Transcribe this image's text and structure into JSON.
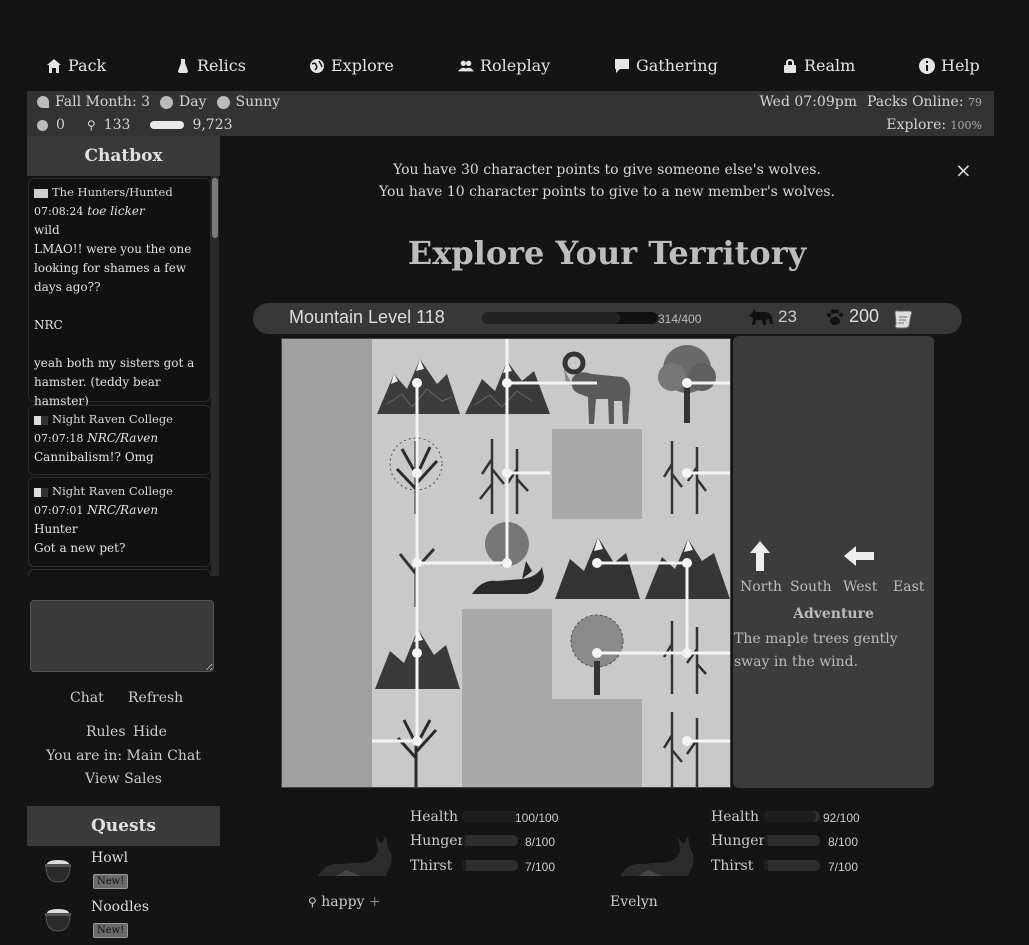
{
  "nav": [
    {
      "label": "Pack",
      "icon": "house-icon"
    },
    {
      "label": "Relics",
      "icon": "flask-icon"
    },
    {
      "label": "Explore",
      "icon": "globe-icon"
    },
    {
      "label": "Roleplay",
      "icon": "users-icon"
    },
    {
      "label": "Gathering",
      "icon": "chat-icon"
    },
    {
      "label": "Realm",
      "icon": "lock-icon"
    },
    {
      "label": "Help",
      "icon": "info-icon"
    }
  ],
  "status": {
    "season": "Fall Month: 3",
    "time_of_day": "Day",
    "weather": "Sunny",
    "datetime": "Wed 07:09pm",
    "packs_online_label": "Packs Online:",
    "packs_online": "79",
    "explore_label": "Explore:",
    "explore_value": "100%",
    "currency_a": "0",
    "currency_b": "133",
    "bones": "9,723"
  },
  "chatbox": {
    "title": "Chatbox",
    "messages": [
      {
        "pack": "The Hunters/Hunted",
        "time": "07:08:24",
        "who": "toe licker",
        "lines": [
          "wild",
          "LMAO!! were you the one looking for shames a few days ago??",
          "",
          "NRC",
          "",
          "yeah both my sisters got a hamster. (teddy bear hamster)"
        ]
      },
      {
        "pack": "Night Raven College",
        "time": "07:07:18",
        "who": "NRC/Raven",
        "lines": [
          "Cannibalism!? Omg"
        ]
      },
      {
        "pack": "Night Raven College",
        "time": "07:07:01",
        "who": "NRC/Raven",
        "lines": [
          "Hunter",
          "Got a new pet?"
        ]
      }
    ],
    "chat_label": "Chat",
    "refresh_label": "Refresh",
    "rules_label": "Rules",
    "hide_label": "Hide",
    "location": "You are in: Main Chat",
    "sales_label": "View Sales"
  },
  "quests": {
    "title": "Quests",
    "items": [
      {
        "name": "Howl",
        "badge": "New!"
      },
      {
        "name": "Noodles",
        "badge": "New!"
      }
    ]
  },
  "notice": {
    "line1": "You have 30 character points to give someone else's wolves.",
    "line2": "You have 10 character points to give to a new member's wolves.",
    "close": "×"
  },
  "page_title": "Explore Your Territory",
  "level": {
    "label": "Mountain Level 118",
    "xp_text": "314/400",
    "xp_current": 314,
    "xp_max": 400,
    "wolves": "23",
    "paws": "200"
  },
  "directions": {
    "north": "North",
    "south": "South",
    "west": "West",
    "east": "East"
  },
  "adventure": {
    "title": "Adventure",
    "text": "The maple trees gently sway in the wind."
  },
  "wolves": [
    {
      "name": "happy",
      "health": "100/100",
      "health_frac": 1.0,
      "hunger": "8/100",
      "hunger_frac": 0.08,
      "thirst": "7/100",
      "thirst_frac": 0.07
    },
    {
      "name": "Evelyn",
      "health": "92/100",
      "health_frac": 0.92,
      "hunger": "8/100",
      "hunger_frac": 0.08,
      "thirst": "7/100",
      "thirst_frac": 0.07
    }
  ],
  "stat_labels": {
    "health": "Health",
    "hunger": "Hunger",
    "thirst": "Thirst"
  }
}
